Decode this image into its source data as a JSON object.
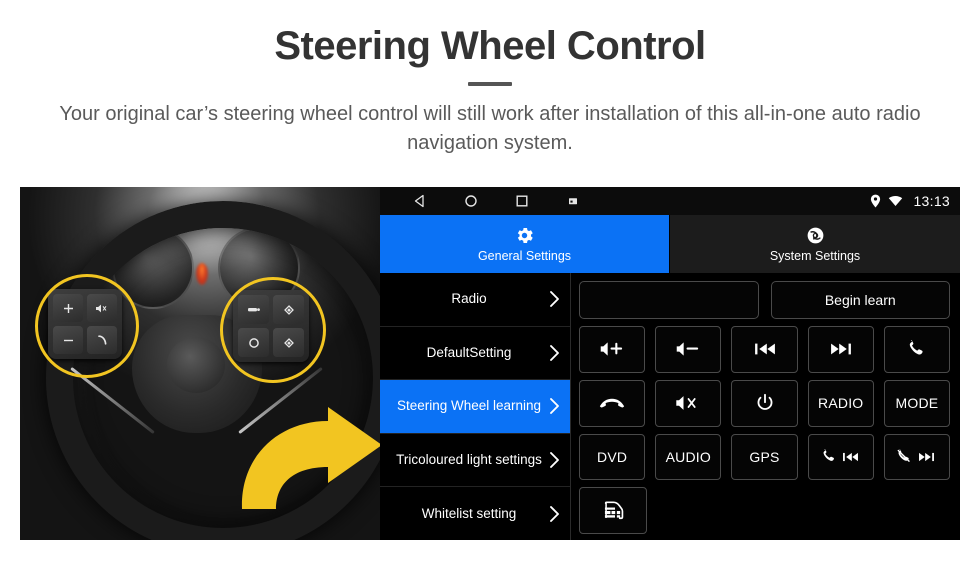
{
  "header": {
    "title": "Steering Wheel Control",
    "subtitle": "Your original car’s steering wheel control will still work after installation of this all-in-one auto radio navigation system."
  },
  "colors": {
    "accent_blue": "#0b72f5",
    "highlight_yellow": "#f2c521",
    "panel_black": "#000000",
    "tab_bar": "#1c1c1c",
    "title_gray": "#333333",
    "subtitle_gray": "#5a5a5a"
  },
  "photo": {
    "alt": "steering-wheel-photo",
    "left_cluster_buttons": [
      "volume-up",
      "mute-icon",
      "volume-down",
      "call-icon"
    ],
    "right_cluster_buttons": [
      "media-icon",
      "diamond-up-icon",
      "circle-icon",
      "diamond-down-icon"
    ],
    "highlight_circles": 2,
    "arrow": "yellow-right-arrow"
  },
  "device": {
    "statusbar": {
      "nav_icons": [
        "back-icon",
        "home-icon",
        "recents-icon",
        "screenshot-icon"
      ],
      "status_icons": [
        "location-pin-icon",
        "wifi-icon"
      ],
      "time": "13:13"
    },
    "tabs": [
      {
        "label": "General Settings",
        "icon": "gear-icon",
        "active": true
      },
      {
        "label": "System Settings",
        "icon": "system-circle-icon",
        "active": false
      }
    ],
    "sidebar": {
      "items": [
        {
          "label": "Radio",
          "active": false
        },
        {
          "label": "DefaultSetting",
          "active": false
        },
        {
          "label": "Steering Wheel learning",
          "active": true
        },
        {
          "label": "Tricoloured light settings",
          "active": false
        },
        {
          "label": "Whitelist setting",
          "active": false
        }
      ]
    },
    "learn_panel": {
      "field_value": "",
      "field_placeholder": "",
      "begin_learn_label": "Begin learn",
      "keys": [
        [
          {
            "name": "volume-up-key",
            "type": "icon",
            "icon": "volume-up-icon",
            "label": ""
          },
          {
            "name": "volume-down-key",
            "type": "icon",
            "icon": "volume-down-icon",
            "label": ""
          },
          {
            "name": "previous-track-key",
            "type": "icon",
            "icon": "previous-icon",
            "label": ""
          },
          {
            "name": "next-track-key",
            "type": "icon",
            "icon": "next-icon",
            "label": ""
          },
          {
            "name": "answer-call-key",
            "type": "icon",
            "icon": "phone-icon",
            "label": ""
          }
        ],
        [
          {
            "name": "hang-up-key",
            "type": "icon",
            "icon": "hangup-icon",
            "label": ""
          },
          {
            "name": "mute-key",
            "type": "icon",
            "icon": "mute-icon",
            "label": ""
          },
          {
            "name": "power-key",
            "type": "icon",
            "icon": "power-icon",
            "label": ""
          },
          {
            "name": "radio-key",
            "type": "text",
            "icon": "",
            "label": "RADIO"
          },
          {
            "name": "mode-key",
            "type": "text",
            "icon": "",
            "label": "MODE"
          }
        ],
        [
          {
            "name": "dvd-key",
            "type": "text",
            "icon": "",
            "label": "DVD"
          },
          {
            "name": "audio-key",
            "type": "text",
            "icon": "",
            "label": "AUDIO"
          },
          {
            "name": "gps-key",
            "type": "text",
            "icon": "",
            "label": "GPS"
          },
          {
            "name": "call-previous-key",
            "type": "dual",
            "icon": "phone-previous-icon",
            "label": ""
          },
          {
            "name": "callmute-next-key",
            "type": "dual",
            "icon": "phonemute-next-icon",
            "label": ""
          }
        ],
        [
          {
            "name": "car-info-key",
            "type": "icon",
            "icon": "car-icon",
            "label": ""
          },
          {
            "name": "empty-slot-1",
            "type": "spacer",
            "icon": "",
            "label": ""
          },
          {
            "name": "empty-slot-2",
            "type": "spacer",
            "icon": "",
            "label": ""
          },
          {
            "name": "empty-slot-3",
            "type": "spacer",
            "icon": "",
            "label": ""
          },
          {
            "name": "empty-slot-4",
            "type": "spacer",
            "icon": "",
            "label": ""
          }
        ]
      ]
    }
  }
}
